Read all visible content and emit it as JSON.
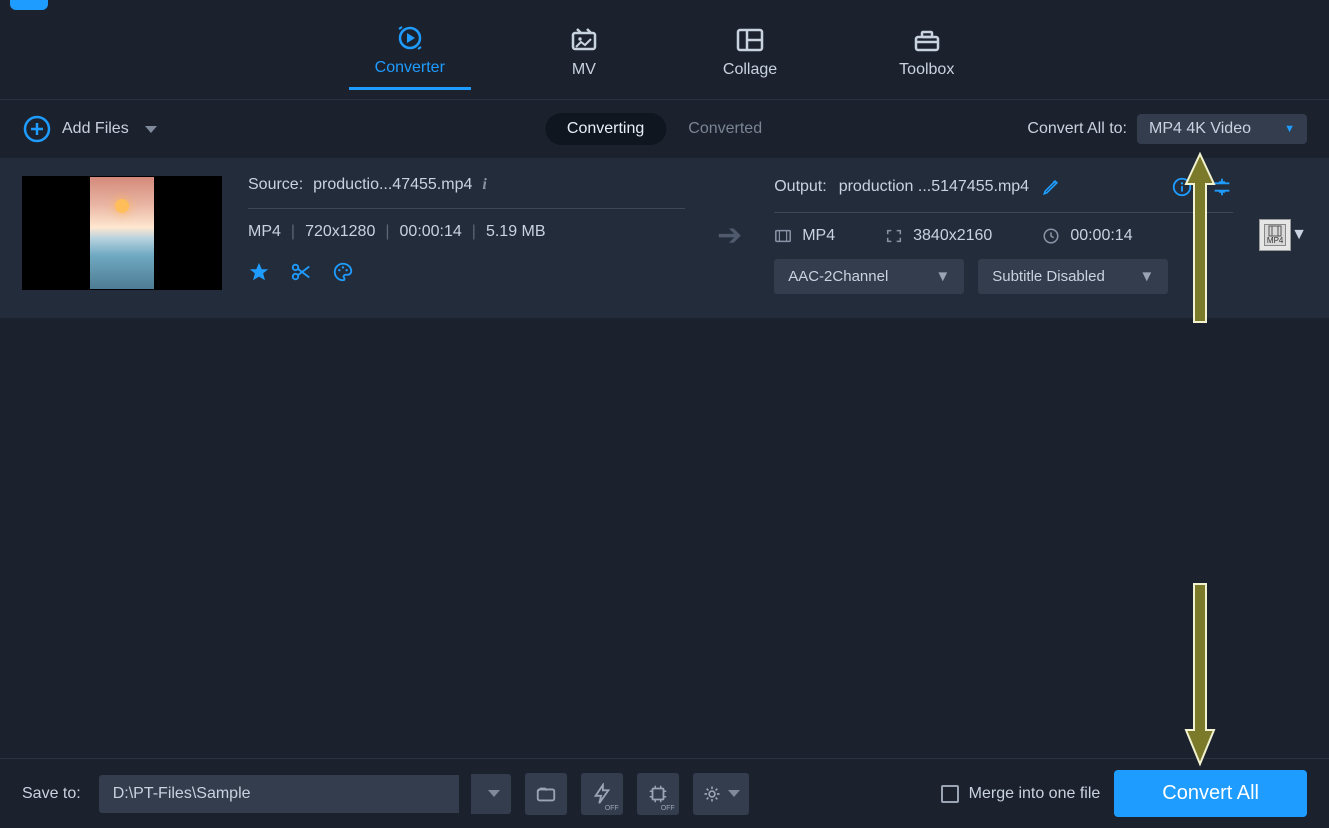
{
  "tabs": {
    "converter": "Converter",
    "mv": "MV",
    "collage": "Collage",
    "toolbox": "Toolbox"
  },
  "subbar": {
    "add_files": "Add Files",
    "converting": "Converting",
    "converted": "Converted",
    "convert_all_to_label": "Convert All to:",
    "convert_all_to_value": "MP4 4K Video"
  },
  "item": {
    "source_label": "Source:",
    "source_file": "productio...47455.mp4",
    "format": "MP4",
    "resolution": "720x1280",
    "duration": "00:00:14",
    "size": "5.19 MB",
    "output_label": "Output:",
    "output_file": "production ...5147455.mp4",
    "out_format": "MP4",
    "out_resolution": "3840x2160",
    "out_duration": "00:00:14",
    "audio_select": "AAC-2Channel",
    "subtitle_select": "Subtitle Disabled",
    "format_badge": "MP4"
  },
  "bottom": {
    "save_to_label": "Save to:",
    "save_path": "D:\\PT-Files\\Sample",
    "merge_label": "Merge into one file",
    "hw_off": "OFF",
    "gpu_off": "OFF",
    "convert_all": "Convert All"
  }
}
